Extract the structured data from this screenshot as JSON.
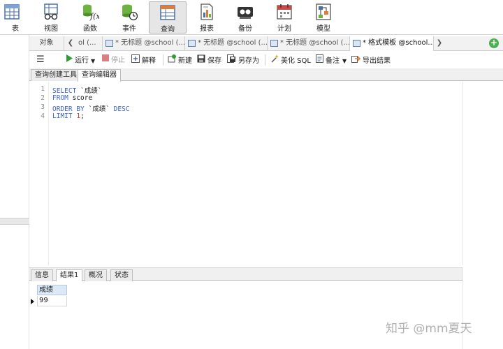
{
  "toolbar": {
    "items": [
      {
        "label": "表",
        "icon": "table-icon"
      },
      {
        "label": "视图",
        "icon": "view-icon"
      },
      {
        "label": "函数",
        "icon": "function-icon"
      },
      {
        "label": "事件",
        "icon": "event-icon"
      },
      {
        "label": "查询",
        "icon": "query-icon",
        "active": true
      },
      {
        "label": "报表",
        "icon": "report-icon"
      },
      {
        "label": "备份",
        "icon": "backup-icon"
      },
      {
        "label": "计划",
        "icon": "schedule-icon"
      },
      {
        "label": "模型",
        "icon": "model-icon"
      }
    ]
  },
  "tabs": {
    "objects_label": "对象",
    "doc_tabs": [
      {
        "label": "ol (..."
      },
      {
        "label": "* 无标题 @school (..."
      },
      {
        "label": "* 无标题 @school (..."
      },
      {
        "label": "* 无标题 @school (..."
      },
      {
        "label": "* 格式模板 @school...",
        "active": true
      }
    ]
  },
  "query_toolbar": {
    "menu_glyph": "☰",
    "run": "运行",
    "stop": "停止",
    "explain": "解释",
    "new": "新建",
    "save": "保存",
    "save_as": "另存为",
    "beautify": "美化 SQL",
    "note": "备注",
    "export": "导出结果"
  },
  "sub_tabs": {
    "builder": "查询创建工具",
    "editor": "查询编辑器"
  },
  "editor": {
    "line_numbers": [
      "1",
      "2",
      "3",
      "4"
    ],
    "lines": [
      {
        "kw": "SELECT",
        "rest": " `成绩`",
        "num": ""
      },
      {
        "kw": "FROM",
        "rest": " score",
        "num": ""
      },
      {
        "kw": "ORDER BY",
        "rest": " `成绩` ",
        "kw2": "DESC",
        "num": ""
      },
      {
        "kw": "LIMIT",
        "rest": " ",
        "num": "1",
        "tail": ";"
      }
    ]
  },
  "result": {
    "tabs": [
      "信息",
      "结果1",
      "概况",
      "状态"
    ],
    "active_tab": "结果1",
    "column_header": "成绩",
    "row_value": "99"
  },
  "watermark": "知乎 @mm夏天",
  "colors": {
    "keyword": "#3e64c4",
    "number": "#c0392b",
    "run_green": "#2e9e2e",
    "stop_red": "#d04545",
    "grid_header_bg": "#dbe8f6"
  }
}
